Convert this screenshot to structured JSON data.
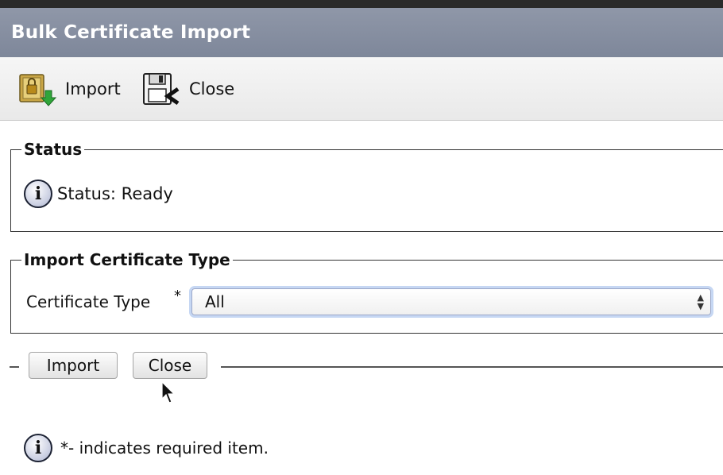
{
  "window": {
    "title": "Bulk Certificate Import"
  },
  "toolbar": {
    "import_label": "Import",
    "import_icon": "lock-import-icon",
    "close_label": "Close",
    "close_icon": "floppy-close-icon"
  },
  "status_section": {
    "legend": "Status",
    "info_glyph": "i",
    "status_text": "Status: Ready"
  },
  "type_section": {
    "legend": "Import Certificate Type",
    "field_label": "Certificate Type",
    "required_marker": "*",
    "selected_value": "All"
  },
  "actions": {
    "import_label": "Import",
    "close_label": "Close"
  },
  "footer": {
    "info_glyph": "i",
    "note": "*- indicates required item."
  }
}
